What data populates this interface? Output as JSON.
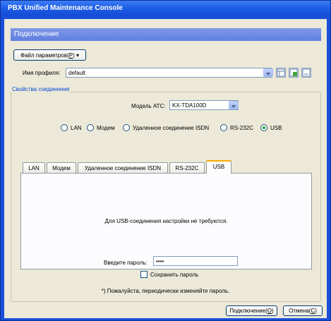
{
  "window": {
    "title": "PBX Unified Maintenance Console"
  },
  "header": {
    "title": "Подключение"
  },
  "params_button": {
    "label": "Файл параметров(",
    "mnemonic": "P",
    "suffix": ")"
  },
  "profile": {
    "label": "Имя профиля:",
    "value": "default"
  },
  "group": {
    "title": "Свойства соединения",
    "model_label": "Модель АТС:",
    "model_value": "KX-TDA100D"
  },
  "connection_types": [
    {
      "label": "LAN",
      "selected": false
    },
    {
      "label": "Модем",
      "selected": false
    },
    {
      "label": "Удаленное соединение ISDN",
      "selected": false
    },
    {
      "label": "RS-232C",
      "selected": false
    },
    {
      "label": "USB",
      "selected": true
    }
  ],
  "tabs": [
    {
      "label": "LAN",
      "active": false
    },
    {
      "label": "Модем",
      "active": false
    },
    {
      "label": "Удаленное соединение ISDN",
      "active": false
    },
    {
      "label": "RS-232C",
      "active": false
    },
    {
      "label": "USB",
      "active": true
    }
  ],
  "usb_panel": {
    "message": "Для USB-соединения настройки не требуются."
  },
  "password": {
    "label": "Введите пароль:",
    "value": "••••"
  },
  "save_password": {
    "label": "Сохранить пароль",
    "checked": false
  },
  "note": "*) Пожалуйста, периодически изменяйте пароль.",
  "buttons": {
    "connect": {
      "label": "Подключение(",
      "mnemonic": "O",
      "suffix": ")"
    },
    "cancel": {
      "label": "Отмена(",
      "mnemonic": "C",
      "suffix": ")"
    }
  },
  "colors": {
    "titlebar": "#1f5fe6",
    "header": "#6d8ce4",
    "group_title": "#0046d5",
    "client_bg": "#ece9d8"
  },
  "icons": [
    "combo-arrow-icon",
    "list-view-icon",
    "add-profile-icon",
    "delete-profile-icon"
  ]
}
